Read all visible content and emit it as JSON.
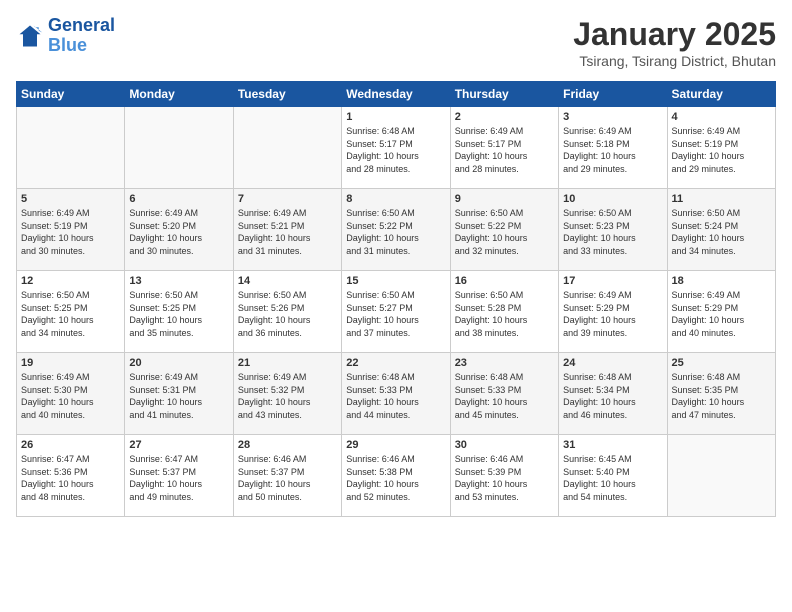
{
  "header": {
    "logo_general": "General",
    "logo_blue": "Blue",
    "month_title": "January 2025",
    "location": "Tsirang, Tsirang District, Bhutan"
  },
  "days_of_week": [
    "Sunday",
    "Monday",
    "Tuesday",
    "Wednesday",
    "Thursday",
    "Friday",
    "Saturday"
  ],
  "weeks": [
    [
      {
        "day": "",
        "text": ""
      },
      {
        "day": "",
        "text": ""
      },
      {
        "day": "",
        "text": ""
      },
      {
        "day": "1",
        "text": "Sunrise: 6:48 AM\nSunset: 5:17 PM\nDaylight: 10 hours\nand 28 minutes."
      },
      {
        "day": "2",
        "text": "Sunrise: 6:49 AM\nSunset: 5:17 PM\nDaylight: 10 hours\nand 28 minutes."
      },
      {
        "day": "3",
        "text": "Sunrise: 6:49 AM\nSunset: 5:18 PM\nDaylight: 10 hours\nand 29 minutes."
      },
      {
        "day": "4",
        "text": "Sunrise: 6:49 AM\nSunset: 5:19 PM\nDaylight: 10 hours\nand 29 minutes."
      }
    ],
    [
      {
        "day": "5",
        "text": "Sunrise: 6:49 AM\nSunset: 5:19 PM\nDaylight: 10 hours\nand 30 minutes."
      },
      {
        "day": "6",
        "text": "Sunrise: 6:49 AM\nSunset: 5:20 PM\nDaylight: 10 hours\nand 30 minutes."
      },
      {
        "day": "7",
        "text": "Sunrise: 6:49 AM\nSunset: 5:21 PM\nDaylight: 10 hours\nand 31 minutes."
      },
      {
        "day": "8",
        "text": "Sunrise: 6:50 AM\nSunset: 5:22 PM\nDaylight: 10 hours\nand 31 minutes."
      },
      {
        "day": "9",
        "text": "Sunrise: 6:50 AM\nSunset: 5:22 PM\nDaylight: 10 hours\nand 32 minutes."
      },
      {
        "day": "10",
        "text": "Sunrise: 6:50 AM\nSunset: 5:23 PM\nDaylight: 10 hours\nand 33 minutes."
      },
      {
        "day": "11",
        "text": "Sunrise: 6:50 AM\nSunset: 5:24 PM\nDaylight: 10 hours\nand 34 minutes."
      }
    ],
    [
      {
        "day": "12",
        "text": "Sunrise: 6:50 AM\nSunset: 5:25 PM\nDaylight: 10 hours\nand 34 minutes."
      },
      {
        "day": "13",
        "text": "Sunrise: 6:50 AM\nSunset: 5:25 PM\nDaylight: 10 hours\nand 35 minutes."
      },
      {
        "day": "14",
        "text": "Sunrise: 6:50 AM\nSunset: 5:26 PM\nDaylight: 10 hours\nand 36 minutes."
      },
      {
        "day": "15",
        "text": "Sunrise: 6:50 AM\nSunset: 5:27 PM\nDaylight: 10 hours\nand 37 minutes."
      },
      {
        "day": "16",
        "text": "Sunrise: 6:50 AM\nSunset: 5:28 PM\nDaylight: 10 hours\nand 38 minutes."
      },
      {
        "day": "17",
        "text": "Sunrise: 6:49 AM\nSunset: 5:29 PM\nDaylight: 10 hours\nand 39 minutes."
      },
      {
        "day": "18",
        "text": "Sunrise: 6:49 AM\nSunset: 5:29 PM\nDaylight: 10 hours\nand 40 minutes."
      }
    ],
    [
      {
        "day": "19",
        "text": "Sunrise: 6:49 AM\nSunset: 5:30 PM\nDaylight: 10 hours\nand 40 minutes."
      },
      {
        "day": "20",
        "text": "Sunrise: 6:49 AM\nSunset: 5:31 PM\nDaylight: 10 hours\nand 41 minutes."
      },
      {
        "day": "21",
        "text": "Sunrise: 6:49 AM\nSunset: 5:32 PM\nDaylight: 10 hours\nand 43 minutes."
      },
      {
        "day": "22",
        "text": "Sunrise: 6:48 AM\nSunset: 5:33 PM\nDaylight: 10 hours\nand 44 minutes."
      },
      {
        "day": "23",
        "text": "Sunrise: 6:48 AM\nSunset: 5:33 PM\nDaylight: 10 hours\nand 45 minutes."
      },
      {
        "day": "24",
        "text": "Sunrise: 6:48 AM\nSunset: 5:34 PM\nDaylight: 10 hours\nand 46 minutes."
      },
      {
        "day": "25",
        "text": "Sunrise: 6:48 AM\nSunset: 5:35 PM\nDaylight: 10 hours\nand 47 minutes."
      }
    ],
    [
      {
        "day": "26",
        "text": "Sunrise: 6:47 AM\nSunset: 5:36 PM\nDaylight: 10 hours\nand 48 minutes."
      },
      {
        "day": "27",
        "text": "Sunrise: 6:47 AM\nSunset: 5:37 PM\nDaylight: 10 hours\nand 49 minutes."
      },
      {
        "day": "28",
        "text": "Sunrise: 6:46 AM\nSunset: 5:37 PM\nDaylight: 10 hours\nand 50 minutes."
      },
      {
        "day": "29",
        "text": "Sunrise: 6:46 AM\nSunset: 5:38 PM\nDaylight: 10 hours\nand 52 minutes."
      },
      {
        "day": "30",
        "text": "Sunrise: 6:46 AM\nSunset: 5:39 PM\nDaylight: 10 hours\nand 53 minutes."
      },
      {
        "day": "31",
        "text": "Sunrise: 6:45 AM\nSunset: 5:40 PM\nDaylight: 10 hours\nand 54 minutes."
      },
      {
        "day": "",
        "text": ""
      }
    ]
  ]
}
